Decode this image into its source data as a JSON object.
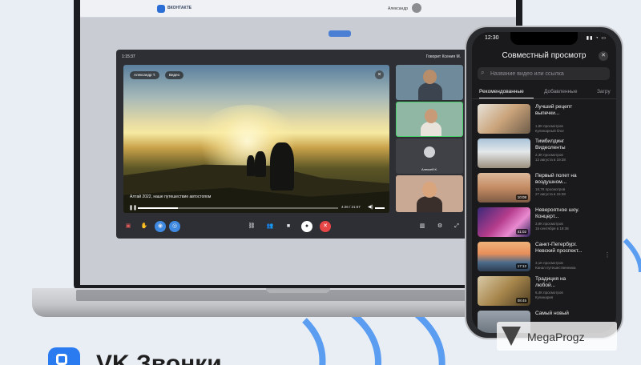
{
  "laptop": {
    "vk_site": {
      "logo_text": "ВКОНТАКТЕ",
      "user_name": "Александр"
    },
    "call": {
      "time": "1:15:37",
      "speaker": "Говорит Ксения М.",
      "presenter_chip": "Александр Т.",
      "video_chip": "Видео",
      "caption": "Алтай 2022, наше путешествие автостопом",
      "video_time": "4:26 / 21:57",
      "progress": 0.2,
      "participant_label": "Алексей К."
    }
  },
  "phone": {
    "status_time": "12:30",
    "sheet_title": "Совместный просмотр",
    "search_placeholder": "Название видео или ссылка",
    "tabs": [
      {
        "label": "Рекомендованные",
        "active": true
      },
      {
        "label": "Добавленные",
        "active": false
      },
      {
        "label": "Загру",
        "active": false
      }
    ],
    "videos": [
      {
        "title": "Лучший рецепт выпечки...",
        "views": "1,8К просмотров",
        "date": "",
        "channel": "Кулинарный блог",
        "duration": ""
      },
      {
        "title": "Тимбилдинг Видеоленты",
        "views": "2,3К просмотров",
        "date": "12 августа в 19:38",
        "channel": "",
        "duration": ""
      },
      {
        "title": "Первый полет на воздушном...",
        "views": "18,7К просмотров",
        "date": "27 августа в 15:38",
        "channel": "",
        "duration": "10:08"
      },
      {
        "title": "Невероятное шоу. Концерт...",
        "views": "3,9К просмотров",
        "date": "15 сентября в 19:38",
        "channel": "",
        "duration": "41:02"
      },
      {
        "title": "Санкт-Петербург. Невский проспект...",
        "views": "3,1К просмотров",
        "date": "",
        "channel": "Канал путешественника",
        "duration": "17:12"
      },
      {
        "title": "Традиция на любой...",
        "views": "6,4К просмотров",
        "date": "",
        "channel": "Кулинария",
        "duration": "08:45"
      },
      {
        "title": "Самый новый",
        "views": "",
        "date": "",
        "channel": "",
        "duration": ""
      }
    ]
  },
  "watermark": "MegaProgz",
  "brand": {
    "name": "VK Звонки"
  },
  "colors": {
    "accent": "#2b7bf0",
    "end_call": "#e64646",
    "active_control": "#3f8ae0"
  }
}
